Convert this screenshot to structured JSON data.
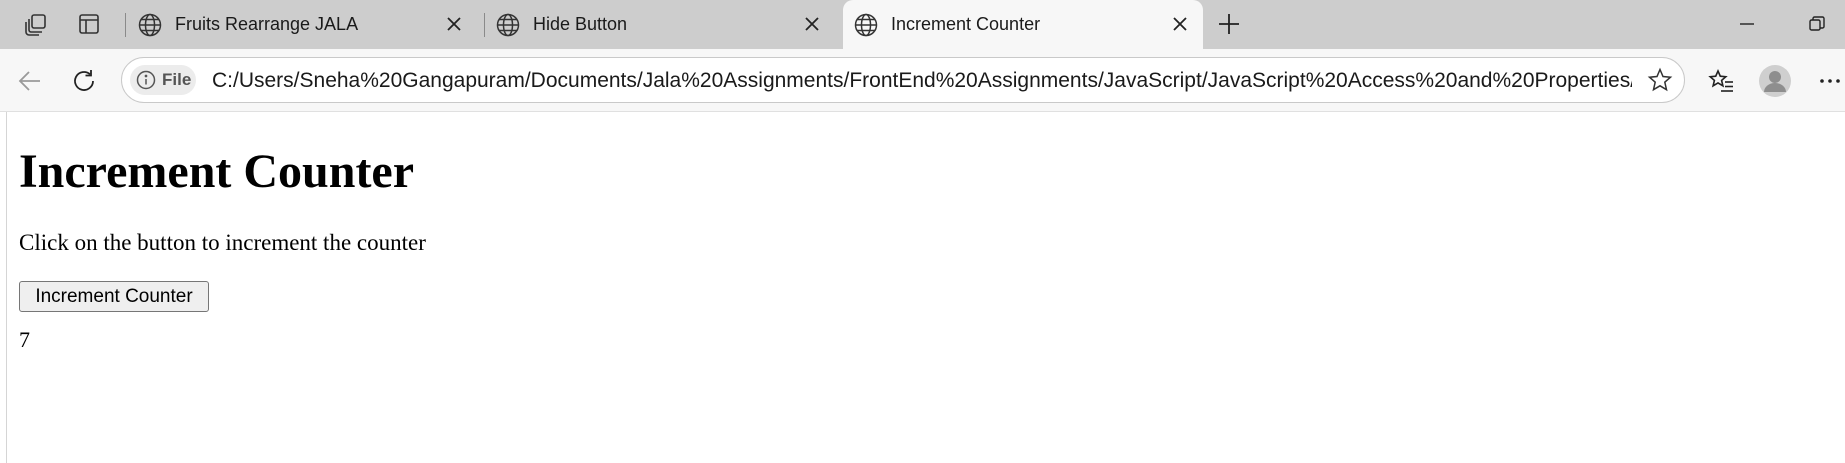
{
  "browser": {
    "tabs": [
      {
        "title": "Fruits Rearrange JALA",
        "active": false,
        "icon": "globe-icon"
      },
      {
        "title": "Hide Button",
        "active": false,
        "icon": "globe-icon"
      },
      {
        "title": "Increment Counter",
        "active": true,
        "icon": "globe-icon"
      }
    ],
    "address": {
      "scheme_label": "File",
      "url": "C:/Users/Sneha%20Gangapuram/Documents/Jala%20Assignments/FrontEnd%20Assignments/JavaScript/JavaScript%20Access%20and%20Properties/In..."
    }
  },
  "page": {
    "heading": "Increment Counter",
    "instruction": "Click on the button to increment the counter",
    "button_label": "Increment Counter",
    "counter_value": "7"
  },
  "colors": {
    "tabstrip_bg": "#cdcdcd",
    "toolbar_bg": "#f7f7f7"
  }
}
